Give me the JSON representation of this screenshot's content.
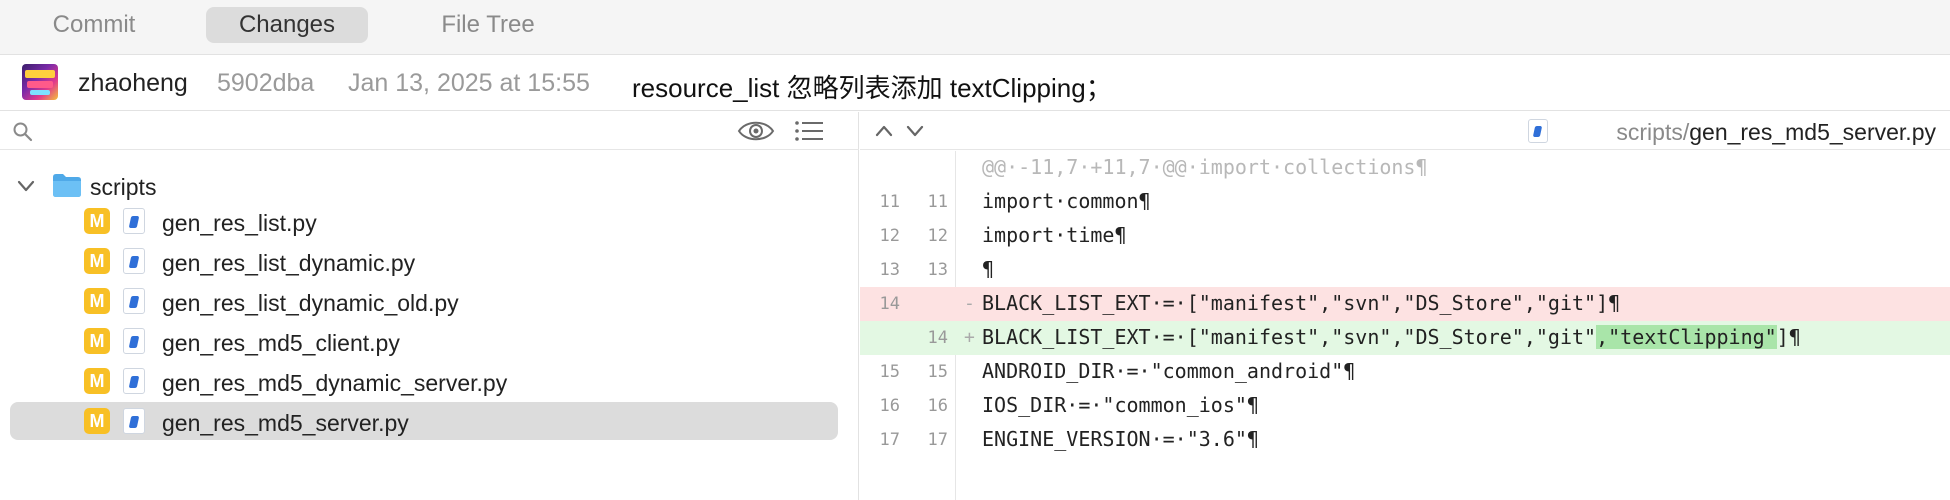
{
  "tabs": {
    "commit": "Commit",
    "changes": "Changes",
    "file_tree": "File Tree",
    "active": "Changes"
  },
  "commit": {
    "author": "zhaoheng",
    "hash": "5902dba",
    "date": "Jan 13, 2025 at 15:55",
    "message": "resource_list 忽略列表添加 textClipping；"
  },
  "sidebar": {
    "search_placeholder": "",
    "folder": "scripts",
    "files": [
      {
        "status": "M",
        "name": "gen_res_list.py"
      },
      {
        "status": "M",
        "name": "gen_res_list_dynamic.py"
      },
      {
        "status": "M",
        "name": "gen_res_list_dynamic_old.py"
      },
      {
        "status": "M",
        "name": "gen_res_md5_client.py"
      },
      {
        "status": "M",
        "name": "gen_res_md5_dynamic_server.py"
      },
      {
        "status": "M",
        "name": "gen_res_md5_server.py"
      }
    ],
    "selected_file": "gen_res_md5_server.py"
  },
  "diff": {
    "path_dir": "scripts/",
    "path_file": "gen_res_md5_server.py",
    "hunk_header": "@@·-11,7·+11,7·@@·import·collections¶",
    "lines": [
      {
        "type": "ctx",
        "old": "11",
        "new": "11",
        "sign": "",
        "text": "import·common¶"
      },
      {
        "type": "ctx",
        "old": "12",
        "new": "12",
        "sign": "",
        "text": "import·time¶"
      },
      {
        "type": "ctx",
        "old": "13",
        "new": "13",
        "sign": "",
        "text": "¶"
      },
      {
        "type": "del",
        "old": "14",
        "new": "",
        "sign": "-",
        "text": "BLACK_LIST_EXT·=·[\"manifest\",\"svn\",\"DS_Store\",\"git\"]¶"
      },
      {
        "type": "add",
        "old": "",
        "new": "14",
        "sign": "+",
        "text_before": "BLACK_LIST_EXT·=·[\"manifest\",\"svn\",\"DS_Store\",\"git\"",
        "text_highlight": ",\"textClipping\"",
        "text_after": "]¶"
      },
      {
        "type": "ctx",
        "old": "15",
        "new": "15",
        "sign": "",
        "text": "ANDROID_DIR·=·\"common_android\"¶"
      },
      {
        "type": "ctx",
        "old": "16",
        "new": "16",
        "sign": "",
        "text": "IOS_DIR·=·\"common_ios\"¶"
      },
      {
        "type": "ctx",
        "old": "17",
        "new": "17",
        "sign": "",
        "text": "ENGINE_VERSION·=·\"3.6\"¶"
      }
    ]
  },
  "colors": {
    "modified_badge": "#f8c025",
    "deleted_line_bg": "#fde2e2",
    "added_line_bg": "#e3f8e3",
    "added_word_highlight": "#a9e5a9"
  }
}
